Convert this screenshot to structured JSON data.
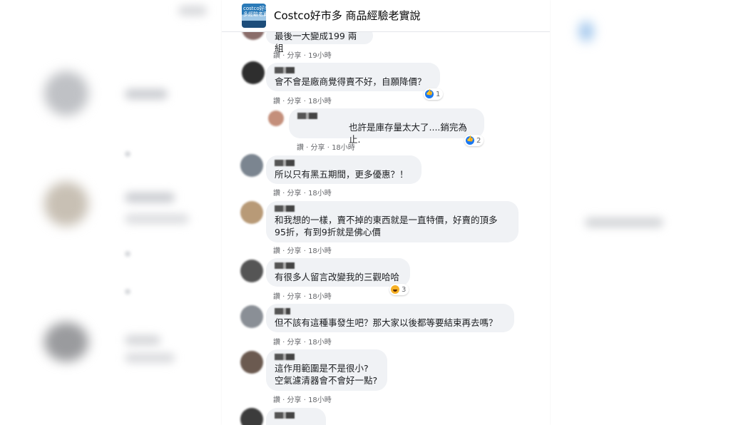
{
  "group": {
    "title": "Costco好市多 商品經驗老實說",
    "avatar_text": "costco好市\n多經驗老實"
  },
  "meta_prefix": "讚 · 分享 · ",
  "comments": [
    {
      "text": "最後一大變成199 兩組",
      "meta": "讚 · 分享 · 19小時"
    },
    {
      "text": "會不會是廠商覺得賣不好，自願降價？",
      "meta": "讚 · 分享 · 18小時",
      "reaction": {
        "type": "like",
        "count": "1"
      }
    },
    {
      "text": "也許是庫存量太大了....銷完為止.",
      "meta": "讚 · 分享 · 18小時",
      "reaction": {
        "type": "like",
        "count": "2"
      }
    },
    {
      "text": "所以只有黑五期間，更多優惠？！",
      "meta": "讚 · 分享 · 18小時"
    },
    {
      "text": "和我想的一樣，賣不掉的東西就是一直特價，好賣的頂多\n95折，有到9折就是佛心價",
      "meta": "讚 · 分享 · 18小時"
    },
    {
      "text": "有很多人留言改變我的三觀哈哈",
      "meta": "讚 · 分享 · 18小時",
      "reaction": {
        "type": "haha",
        "count": "3"
      }
    },
    {
      "text": "但不該有這種事發生吧？那大家以後都等要結束再去嗎？",
      "meta": "讚 · 分享 · 18小時"
    },
    {
      "text": "這作用範圍是不是很小?\n空氣濾清器會不會好一點?",
      "meta": "讚 · 分享 · 18小時"
    }
  ],
  "colors": {
    "bubble": "#f0f2f5",
    "meta": "#65676b",
    "like": "#1877f2",
    "haha": "#f7b125"
  }
}
